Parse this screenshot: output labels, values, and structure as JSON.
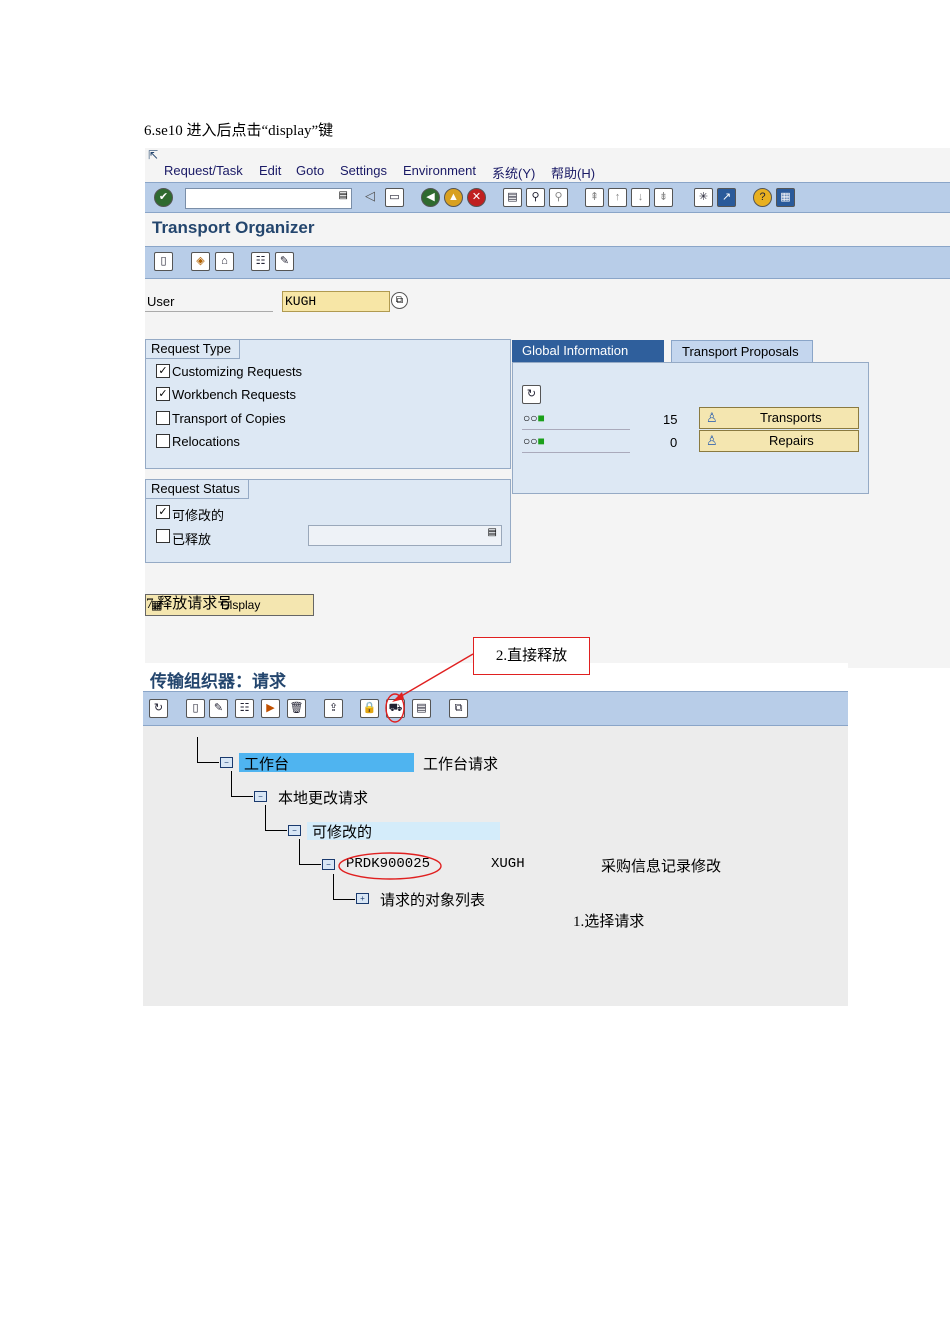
{
  "doc": {
    "step6_caption": "6.se10 进入后点击“display”键",
    "step7_caption": "7.释放请求号",
    "callout_release": "2.直接释放",
    "callout_select": "1.选择请求"
  },
  "screen1": {
    "menu": [
      "Request/Task",
      "Edit",
      "Goto",
      "Settings",
      "Environment",
      "系统(Y)",
      "帮助(H)"
    ],
    "title": "Transport Organizer",
    "user_label": "User",
    "user_value": "KUGH",
    "request_type": {
      "title": "Request Type",
      "items": [
        {
          "label": "Customizing Requests",
          "checked": true
        },
        {
          "label": "Workbench Requests",
          "checked": true
        },
        {
          "label": "Transport of Copies",
          "checked": false
        },
        {
          "label": "Relocations",
          "checked": false
        }
      ]
    },
    "request_status": {
      "title": "Request Status",
      "items": [
        {
          "label": "可修改的",
          "checked": true
        },
        {
          "label": "已释放",
          "checked": false
        }
      ]
    },
    "tabs": [
      "Global Information",
      "Transport Proposals"
    ],
    "global_info": [
      {
        "count": "15",
        "button": "Transports"
      },
      {
        "count": "0",
        "button": "Repairs"
      }
    ],
    "display_button": "Display"
  },
  "screen2": {
    "title": "传输组织器：请求",
    "tree": {
      "workbench": "工作台",
      "workbench_desc": "工作台请求",
      "local": "本地更改请求",
      "modifiable": "可修改的",
      "request_id": "PRDK900025",
      "request_owner": "XUGH",
      "request_desc": "采购信息记录修改",
      "object_list": "请求的对象列表"
    }
  },
  "colors": {
    "toolbar": "#b8cde8",
    "title": "#24466e",
    "highlight": "#4fb4f0",
    "callout": "#e02020"
  }
}
